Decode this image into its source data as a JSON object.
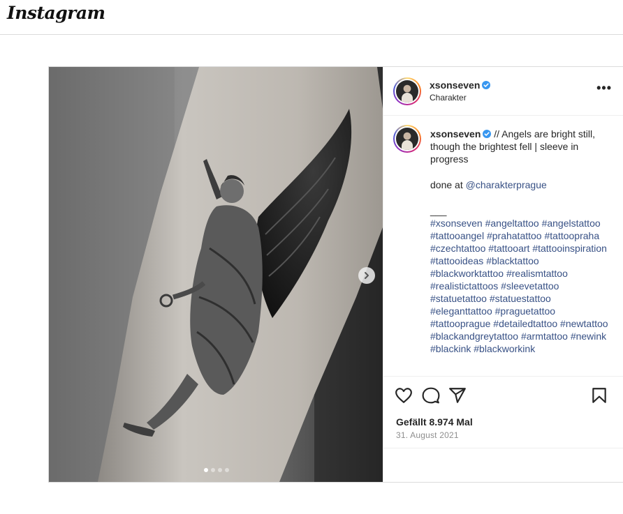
{
  "app": {
    "logo_text": "Instagram"
  },
  "post": {
    "username": "xsonseven",
    "verified": true,
    "subtitle": "Charakter",
    "more_label": "•••",
    "caption": {
      "text": "// Angels are bright still, though the brightest fell | sleeve in progress",
      "done_at": "done at",
      "mention": "@charakterprague",
      "separator": "___",
      "hashtags": [
        "#xsonseven",
        "#angeltattoo",
        "#angelstattoo",
        "#tattooangel",
        "#prahatattoo",
        "#tattoopraha",
        "#czechtattoo",
        "#tattooart",
        "#tattooinspiration",
        "#tattooideas",
        "#blacktattoo",
        "#blackworktattoo",
        "#realismtattoo",
        "#realistictattoos",
        "#sleevetattoo",
        "#statuetattoo",
        "#statuestattoo",
        "#eleganttattoo",
        "#praguetattoo",
        "#tattooprague",
        "#detailedtattoo",
        "#newtattoo",
        "#blackandgreytattoo",
        "#armtattoo",
        "#newink",
        "#blackink",
        "#blackworkink"
      ]
    },
    "likes": "Gefällt 8.974 Mal",
    "date": "31. August 2021",
    "carousel": {
      "total": 4,
      "current": 1
    }
  },
  "icons": {
    "like": "heart-icon",
    "comment": "comment-icon",
    "share": "send-icon",
    "save": "bookmark-icon",
    "next": "chevron-right-icon",
    "verified": "verified-badge-icon"
  },
  "colors": {
    "link": "#385185",
    "verified": "#3897f0",
    "muted": "#8e8e8e",
    "border": "#dbdbdb"
  }
}
